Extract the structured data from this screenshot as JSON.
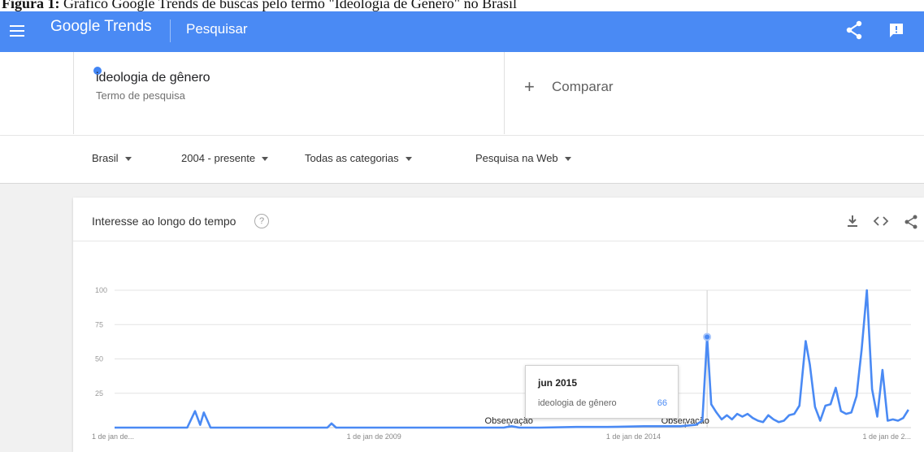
{
  "caption": {
    "bold": "Figura 1:",
    "text": " Gráfico Google Trends de buscas pelo termo \"Ideologia de Gênero\" no Brasil"
  },
  "topbar": {
    "brand": "Google Trends",
    "section": "Pesquisar",
    "color": "#4a8af4",
    "icons": [
      "menu-icon",
      "share-icon",
      "feedback-icon"
    ]
  },
  "term": {
    "name": "ideologia de gênero",
    "subtitle": "Termo de pesquisa",
    "dot_color": "#4285f4"
  },
  "compare": {
    "plus": "+",
    "label": "Comparar"
  },
  "filters": {
    "region": "Brasil",
    "period": "2004 - presente",
    "category": "Todas as categorias",
    "search_type": "Pesquisa na Web"
  },
  "card": {
    "title": "Interesse ao longo do tempo",
    "help": "?",
    "icons": [
      "download-icon",
      "embed-icon",
      "share-icon"
    ]
  },
  "tooltip": {
    "date": "jun 2015",
    "term": "ideologia de gênero",
    "value": "66"
  },
  "chart_data": {
    "type": "line",
    "title": "Interesse ao longo do tempo",
    "xlabel": "",
    "ylabel": "",
    "ylim": [
      0,
      100
    ],
    "yticks": [
      "100",
      "75",
      "50",
      "25"
    ],
    "xticks": [
      "1 de jan de...",
      "1 de jan de 2009",
      "1 de jan de 2014",
      "1 de jan de 2..."
    ],
    "xtick_dates": [
      2004.0,
      2009.0,
      2014.0,
      2019.0
    ],
    "annotations": [
      {
        "text": "Observação",
        "date": 2011.6
      },
      {
        "text": "Observação",
        "date": 2015.0
      }
    ],
    "grid": true,
    "line_color": "#4a8af4",
    "highlight": {
      "date": 2015.42,
      "value": 66
    },
    "series": [
      {
        "name": "ideologia de gênero",
        "points": [
          [
            2004.0,
            0
          ],
          [
            2005.4,
            0
          ],
          [
            2005.55,
            12
          ],
          [
            2005.65,
            2
          ],
          [
            2005.72,
            11
          ],
          [
            2005.85,
            0
          ],
          [
            2008.1,
            0
          ],
          [
            2008.18,
            3
          ],
          [
            2008.27,
            0
          ],
          [
            2011.5,
            0
          ],
          [
            2011.65,
            1
          ],
          [
            2011.8,
            0
          ],
          [
            2012.2,
            0
          ],
          [
            2012.9,
            0.5
          ],
          [
            2013.5,
            0.5
          ],
          [
            2014.2,
            1
          ],
          [
            2014.9,
            1
          ],
          [
            2015.2,
            2
          ],
          [
            2015.33,
            5
          ],
          [
            2015.42,
            66
          ],
          [
            2015.5,
            17
          ],
          [
            2015.6,
            11
          ],
          [
            2015.7,
            6
          ],
          [
            2015.8,
            9
          ],
          [
            2015.9,
            6
          ],
          [
            2016.0,
            10
          ],
          [
            2016.1,
            8
          ],
          [
            2016.2,
            10
          ],
          [
            2016.3,
            7
          ],
          [
            2016.4,
            5
          ],
          [
            2016.5,
            4
          ],
          [
            2016.6,
            9
          ],
          [
            2016.7,
            6
          ],
          [
            2016.8,
            4
          ],
          [
            2016.9,
            5
          ],
          [
            2017.0,
            9
          ],
          [
            2017.1,
            10
          ],
          [
            2017.2,
            16
          ],
          [
            2017.32,
            63
          ],
          [
            2017.4,
            46
          ],
          [
            2017.5,
            15
          ],
          [
            2017.6,
            5
          ],
          [
            2017.7,
            16
          ],
          [
            2017.8,
            17
          ],
          [
            2017.9,
            29
          ],
          [
            2018.0,
            12
          ],
          [
            2018.1,
            10
          ],
          [
            2018.2,
            11
          ],
          [
            2018.3,
            23
          ],
          [
            2018.4,
            57
          ],
          [
            2018.5,
            100
          ],
          [
            2018.6,
            28
          ],
          [
            2018.7,
            8
          ],
          [
            2018.8,
            42
          ],
          [
            2018.9,
            5
          ],
          [
            2019.0,
            6
          ],
          [
            2019.1,
            5
          ],
          [
            2019.2,
            7
          ],
          [
            2019.3,
            13
          ]
        ]
      }
    ]
  }
}
